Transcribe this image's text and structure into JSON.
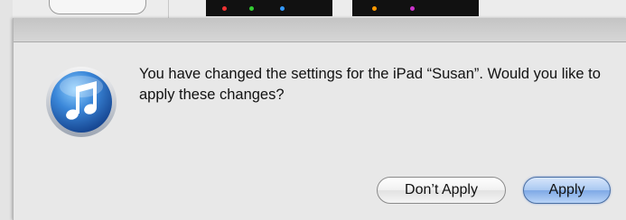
{
  "dialog": {
    "message": "You have changed the settings for the iPad “Susan”. Would you like to apply these changes?",
    "dont_apply_label": "Don’t Apply",
    "apply_label": "Apply"
  },
  "icons": {
    "app_icon": "itunes-music-note-icon"
  },
  "colors": {
    "default_button": "#8fb6ee",
    "icon_blue": "#2f6fc4"
  }
}
